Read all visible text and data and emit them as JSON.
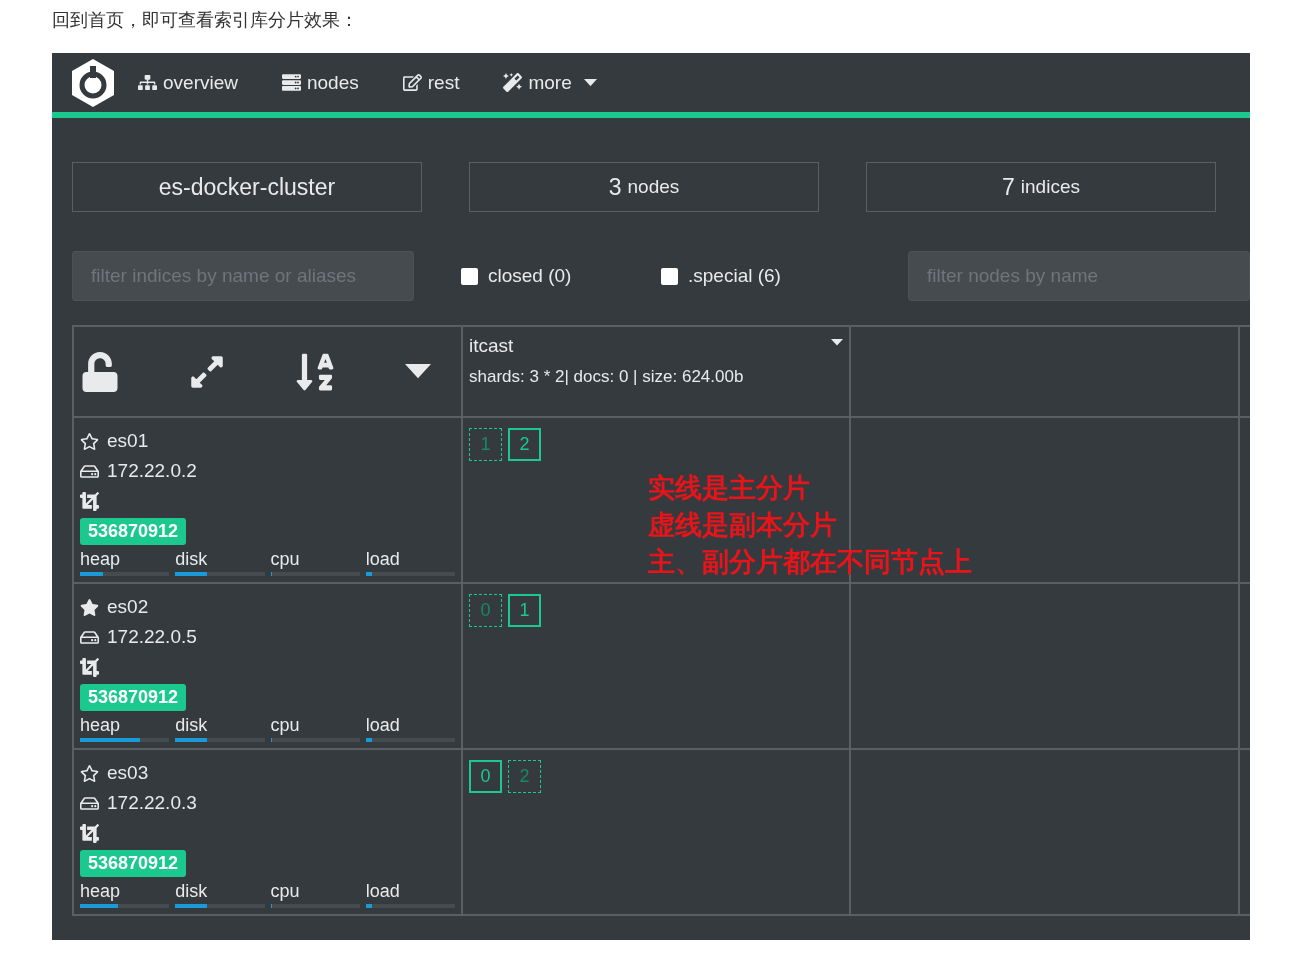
{
  "intro": "回到首页，即可查看索引库分片效果：",
  "nav": [
    {
      "label": "overview",
      "kind": "overview"
    },
    {
      "label": "nodes",
      "kind": "nodes"
    },
    {
      "label": "rest",
      "kind": "rest"
    },
    {
      "label": "more",
      "kind": "more"
    }
  ],
  "stats": [
    {
      "value": "es-docker-cluster"
    },
    {
      "value": "3",
      "label": "nodes"
    },
    {
      "value": "7",
      "label": "indices"
    }
  ],
  "filters": {
    "indices_placeholder": "filter indices by name or aliases",
    "nodes_placeholder": "filter nodes by name",
    "checkboxes": [
      {
        "label": "closed (0)",
        "checked": false
      },
      {
        "label": ".special (6)",
        "checked": false
      }
    ]
  },
  "index": {
    "name": "itcast",
    "info": "shards: 3 * 2| docs: 0 | size: 624.00b"
  },
  "nodes": [
    {
      "name": "es01",
      "master": false,
      "ip": "172.22.0.2",
      "badge": "536870912",
      "metrics": [
        {
          "label": "heap",
          "level": 0.26
        },
        {
          "label": "disk",
          "level": 0.36
        },
        {
          "label": "cpu",
          "level": 0
        },
        {
          "label": "load",
          "level": 0.07
        }
      ],
      "shards": [
        {
          "number": "1",
          "primary": false
        },
        {
          "number": "2",
          "primary": true
        }
      ]
    },
    {
      "name": "es02",
      "master": true,
      "ip": "172.22.0.5",
      "badge": "536870912",
      "metrics": [
        {
          "label": "heap",
          "level": 0.67
        },
        {
          "label": "disk",
          "level": 0.36
        },
        {
          "label": "cpu",
          "level": 0
        },
        {
          "label": "load",
          "level": 0.07
        }
      ],
      "shards": [
        {
          "number": "0",
          "primary": false
        },
        {
          "number": "1",
          "primary": true
        }
      ]
    },
    {
      "name": "es03",
      "master": false,
      "ip": "172.22.0.3",
      "badge": "536870912",
      "metrics": [
        {
          "label": "heap",
          "level": 0.43
        },
        {
          "label": "disk",
          "level": 0.36
        },
        {
          "label": "cpu",
          "level": 0
        },
        {
          "label": "load",
          "level": 0.07
        }
      ],
      "shards": [
        {
          "number": "0",
          "primary": true
        },
        {
          "number": "2",
          "primary": false
        }
      ]
    }
  ],
  "annotation": [
    "实线是主分片",
    "虚线是副本分片",
    "主、副分片都在不同节点上"
  ]
}
